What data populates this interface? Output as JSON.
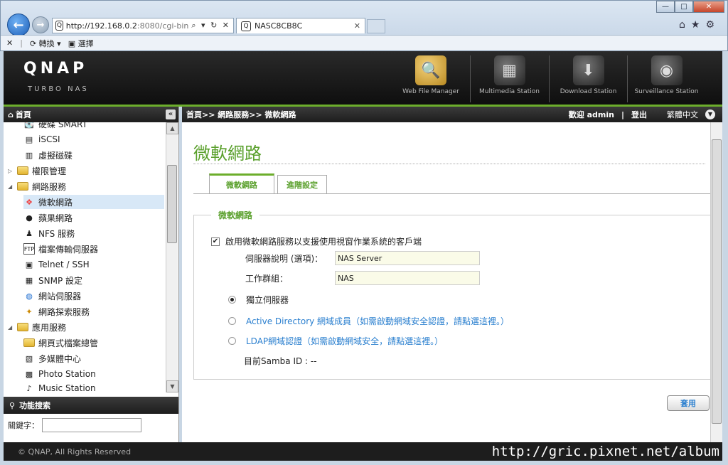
{
  "browser": {
    "url_main": "http://192.168.0.2",
    "url_rest": ":8080/cgi-bin",
    "tab_title": "NASC8CB8C",
    "cmd_convert": "轉換",
    "cmd_select": "選擇"
  },
  "header": {
    "logo": "QNAP",
    "subtitle": "TURBO NAS",
    "apps": [
      {
        "label": "Web File Manager",
        "icon": "folder-magnifier-icon"
      },
      {
        "label": "Multimedia Station",
        "icon": "multimedia-icon"
      },
      {
        "label": "Download Station",
        "icon": "download-icon"
      },
      {
        "label": "Surveillance Station",
        "icon": "camera-icon"
      }
    ]
  },
  "sidebar": {
    "title": "首頁",
    "items": [
      {
        "label": "硬碟 SMART"
      },
      {
        "label": "iSCSI"
      },
      {
        "label": "虛擬磁碟"
      },
      {
        "label": "權限管理"
      },
      {
        "label": "網路服務"
      },
      {
        "label": "微軟網路"
      },
      {
        "label": "蘋果網路"
      },
      {
        "label": "NFS 服務"
      },
      {
        "label": "檔案傳輸伺服器"
      },
      {
        "label": "Telnet / SSH"
      },
      {
        "label": "SNMP 設定"
      },
      {
        "label": "網站伺服器"
      },
      {
        "label": "網路探索服務"
      },
      {
        "label": "應用服務"
      },
      {
        "label": "網頁式檔案總管"
      },
      {
        "label": "多媒體中心"
      },
      {
        "label": "Photo Station"
      },
      {
        "label": "Music Station"
      }
    ],
    "search_title": "功能搜索",
    "search_label": "關鍵字："
  },
  "main": {
    "breadcrumb": "首頁>> 網路服務>> 微軟網路",
    "welcome": "歡迎 admin",
    "separator": "|",
    "logout": "登出",
    "language": "繁體中文",
    "page_title": "微軟網路",
    "tabs": [
      "微軟網路",
      "進階設定"
    ],
    "legend": "微軟網路",
    "enable_label": "啟用微軟網路服務以支援使用視窗作業系統的客戶端",
    "server_desc_label": "伺服器說明 (選項)：",
    "server_desc_value": "NAS Server",
    "workgroup_label": "工作群組：",
    "workgroup_value": "NAS",
    "radio_standalone": "獨立伺服器",
    "radio_ad": "Active Directory 網域成員（如需啟動網域安全認證，請點選這裡。）",
    "radio_ldap": "LDAP網域認證（如需啟動網域安全，請點選這裡。）",
    "samba_id": "目前Samba ID : --",
    "apply": "套用"
  },
  "footer": {
    "copyright": "© QNAP, All Rights Reserved",
    "watermark": "http://gric.pixnet.net/album"
  }
}
